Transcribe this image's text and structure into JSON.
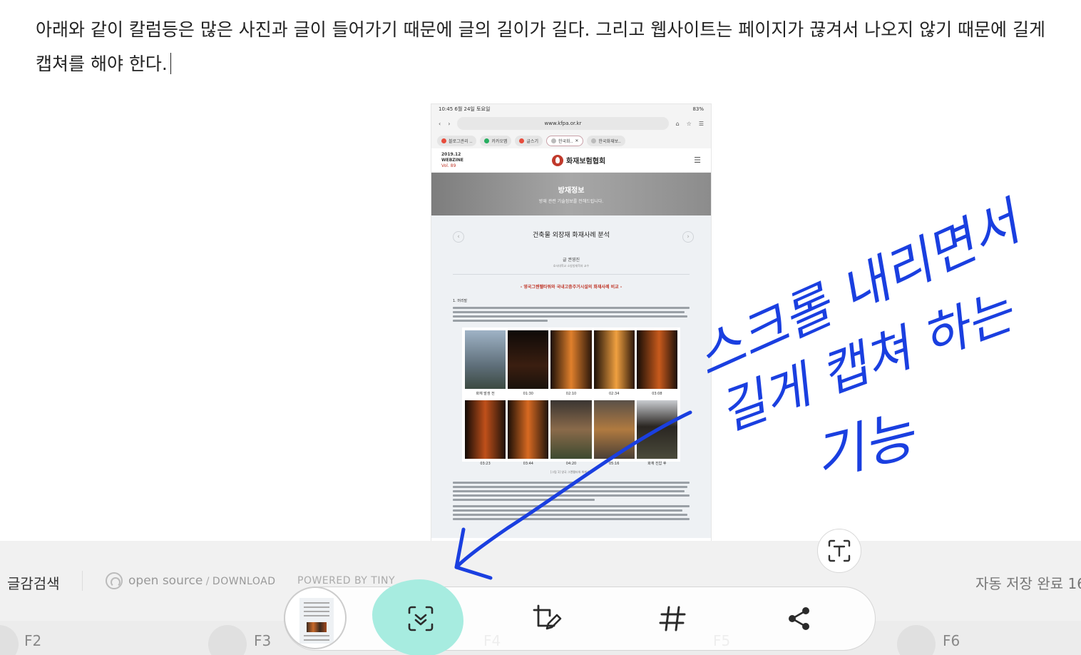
{
  "editor": {
    "line1": "아래와 같이 칼럼등은 많은 사진과 글이 들어가기 때문에 글의 길이가 길다. 그리고 웹사이트는 페이지가 끊겨서 나오지 않기 때문에 길게",
    "line2": "캡쳐를 해야 한다."
  },
  "screenshot": {
    "status_time": "10:45  6월 24일 토요일",
    "status_battery": "83%",
    "url": "www.kfpa.or.kr",
    "tabs": [
      "블로그관리 ..",
      "카카오맵",
      "글스기",
      "한국화..",
      "한국화재보.."
    ],
    "webzine_date": "2019.12",
    "webzine_label": "WEBZINE",
    "webzine_vol": "Vol. 89",
    "site_name": "화재보험협회",
    "hero_title": "방재정보",
    "hero_sub": "방재 관련 기술정보를 전해드립니다.",
    "article_title": "건축물 외장재 화재사례 분석",
    "author": "글 권영진",
    "author_sub": "호서대학교 소방방재학과 교수",
    "article_sub": "- 영국그렌펠타워와 국내고층주거시설의 화재사례 비교 -",
    "section_1": "1. 머리말",
    "photo_captions": [
      "화재 발생 전",
      "01:30",
      "02:10",
      "02:34",
      "03:08",
      "03:23",
      "03:44",
      "04:20",
      "05:16",
      "화재 진압 후"
    ],
    "figure_caption": "[그림 1] 영국 그렌펠타워 화재사례"
  },
  "annotation": {
    "line1": "스크롤 내리면서",
    "line2": "길게 캡쳐 하는",
    "line3": "기능",
    "color": "#1a3fe0"
  },
  "footer": {
    "search_label": "글감검색",
    "opensource": "open source",
    "download": "DOWNLOAD",
    "powered": "POWERED BY TINY",
    "autosave": "자동 저장 완료 16"
  },
  "fkeys": [
    "F2",
    "F3",
    "F4",
    "F5",
    "F6"
  ],
  "toolbar": {
    "scroll_capture_color": "#a7ece0"
  }
}
